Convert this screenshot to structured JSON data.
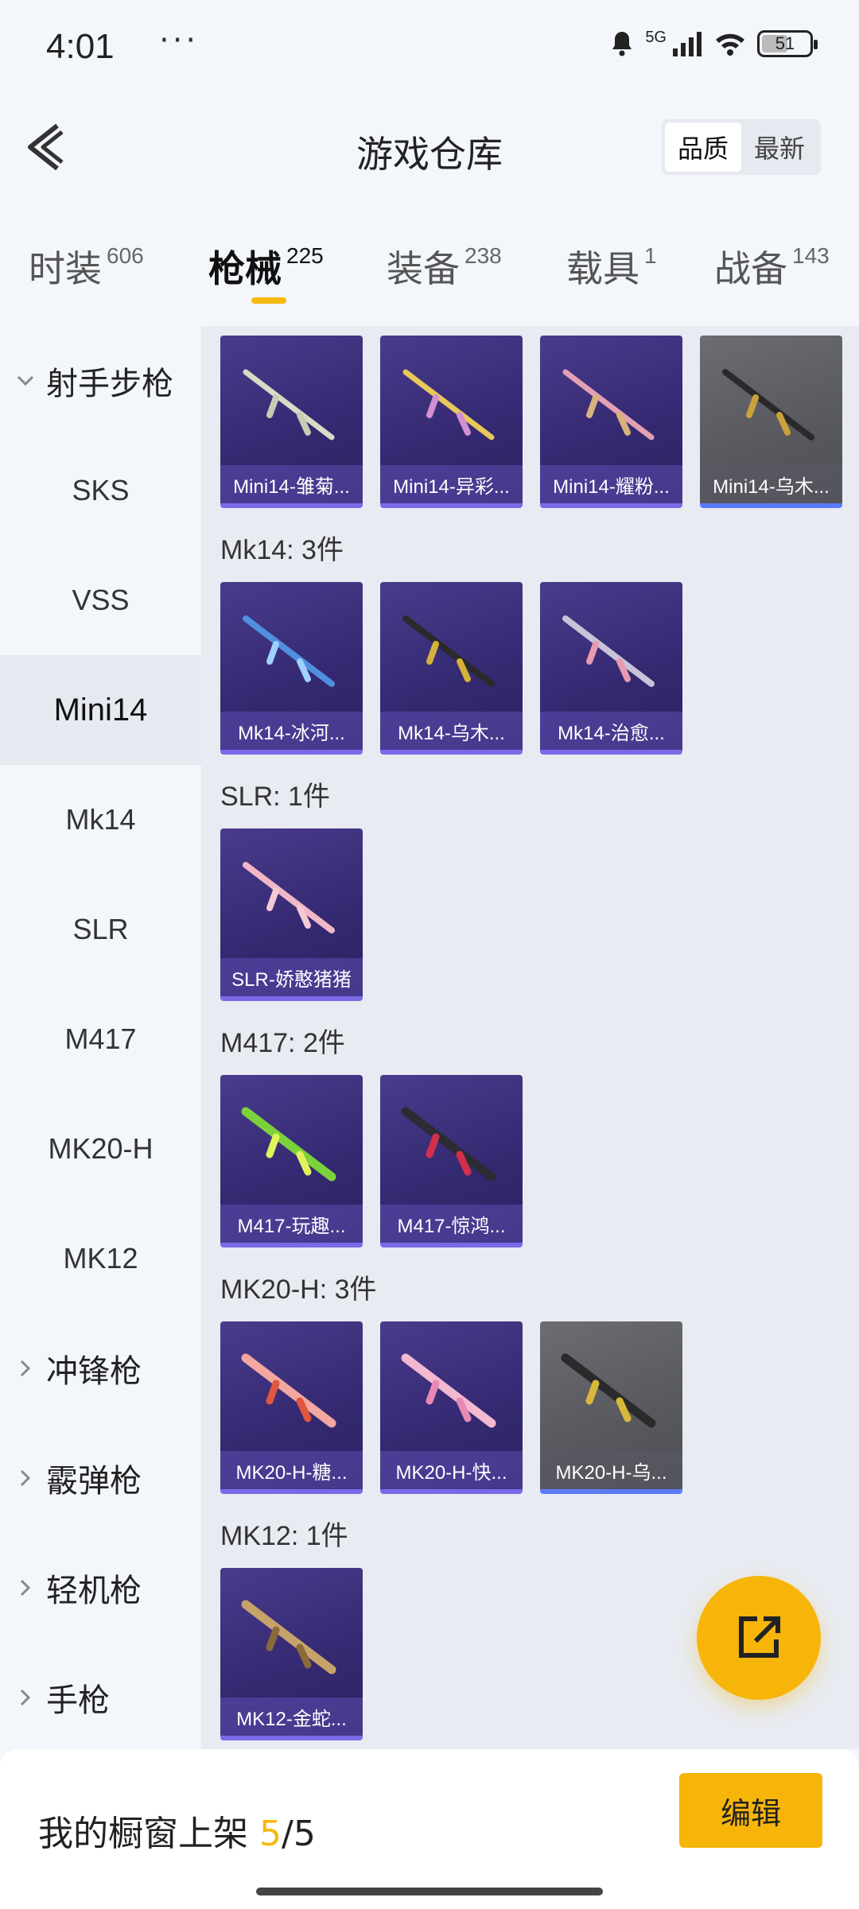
{
  "status": {
    "time": "4:01",
    "dots": "···",
    "network": "5G",
    "battery": "51"
  },
  "header": {
    "title": "游戏仓库",
    "sort_quality": "品质",
    "sort_latest": "最新"
  },
  "tabs": [
    {
      "label": "时装",
      "count": "606"
    },
    {
      "label": "枪械",
      "count": "225"
    },
    {
      "label": "装备",
      "count": "238"
    },
    {
      "label": "载具",
      "count": "1"
    },
    {
      "label": "战备",
      "count": "143"
    }
  ],
  "sidebar": {
    "group_marksman": "射手步枪",
    "items": [
      "SKS",
      "VSS",
      "Mini14",
      "Mk14",
      "SLR",
      "M417",
      "MK20-H",
      "MK12"
    ],
    "group_smg": "冲锋枪",
    "group_shotgun": "霰弹枪",
    "group_lmg": "轻机枪",
    "group_pistol": "手枪"
  },
  "sections": {
    "mini14": {
      "items": [
        "Mini14-雏菊...",
        "Mini14-异彩...",
        "Mini14-耀粉...",
        "Mini14-乌木..."
      ]
    },
    "mk14": {
      "title": "Mk14: 3件",
      "items": [
        "Mk14-冰河...",
        "Mk14-乌木...",
        "Mk14-治愈..."
      ]
    },
    "slr": {
      "title": "SLR: 1件",
      "items": [
        "SLR-娇憨猪猪"
      ]
    },
    "m417": {
      "title": "M417: 2件",
      "items": [
        "M417-玩趣...",
        "M417-惊鸿..."
      ]
    },
    "mk20h": {
      "title": "MK20-H: 3件",
      "items": [
        "MK20-H-糖...",
        "MK20-H-快...",
        "MK20-H-乌..."
      ]
    },
    "mk12": {
      "title": "MK12: 1件",
      "items": [
        "MK12-金蛇..."
      ]
    }
  },
  "bottom": {
    "label": "我的橱窗上架",
    "shown": "5",
    "total": "/5",
    "edit": "编辑"
  },
  "colors": {
    "accent": "#f7b50a",
    "card_purple": "#352a73",
    "card_gray": "#58585f"
  }
}
